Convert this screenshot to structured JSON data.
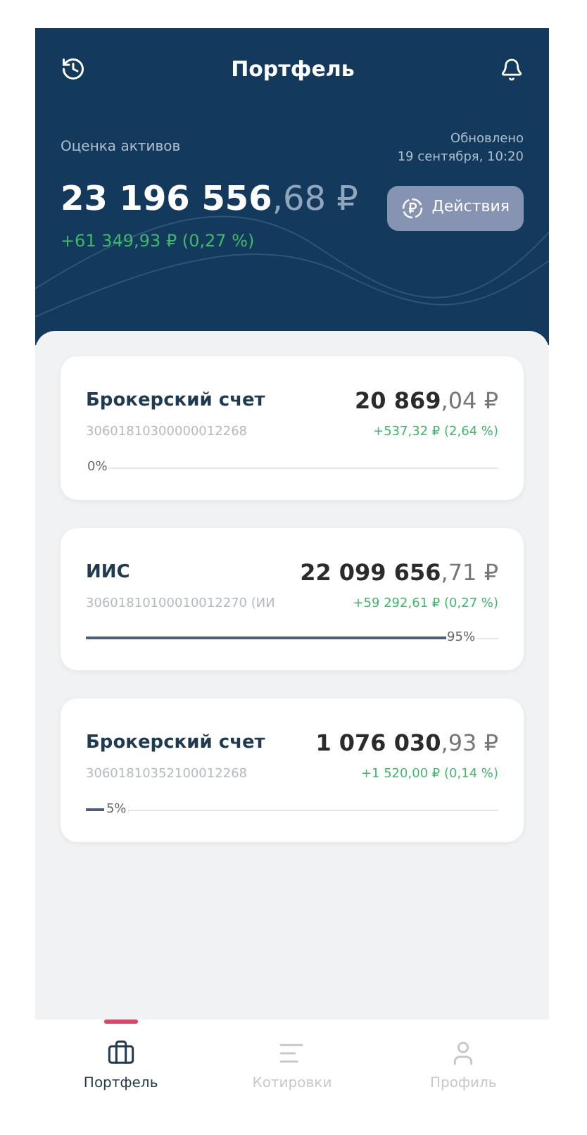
{
  "header": {
    "title": "Портфель",
    "assets_label": "Оценка активов",
    "updated_label": "Обновлено",
    "updated_time": "19 сентября, 10:20",
    "total_whole": "23 196 556",
    "total_fraction": ",68 ₽",
    "total_change": "+61 349,93 ₽ (0,27 %)",
    "actions_button": "Действия"
  },
  "accounts": [
    {
      "name": "Брокерский счет",
      "number": "30601810300000012268",
      "amount_whole": "20 869",
      "amount_fraction": ",04 ₽",
      "change": "+537,32 ₽ (2,64 %)",
      "share": "0%",
      "level": 0
    },
    {
      "name": "ИИС",
      "number": "30601810100010012270 (ИИ",
      "amount_whole": "22 099 656",
      "amount_fraction": ",71 ₽",
      "change": "+59 292,61 ₽ (0,27 %)",
      "share": "95%",
      "level": 0.95
    },
    {
      "name": "Брокерский счет",
      "number": "30601810352100012268",
      "amount_whole": "1 076 030",
      "amount_fraction": ",93 ₽",
      "change": "+1 520,00 ₽ (0,14 %)",
      "share": "5%",
      "level": 0.05
    }
  ],
  "tabs": [
    {
      "label": "Портфель",
      "kind": "briefcase",
      "selected": true
    },
    {
      "label": "Котировки",
      "kind": "list",
      "selected": false
    },
    {
      "label": "Профиль",
      "kind": "person",
      "selected": false
    }
  ]
}
